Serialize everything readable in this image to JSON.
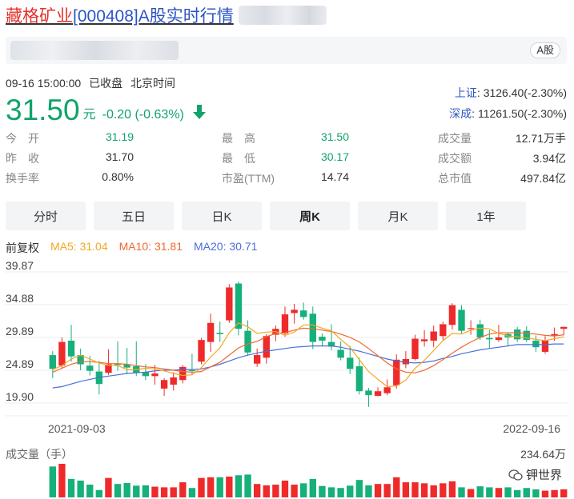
{
  "header": {
    "stock_name": "藏格矿业",
    "stock_suffix": "[000408]A股实时行情",
    "market_badge": "A股"
  },
  "quote": {
    "timestamp": "09-16 15:00:00",
    "status": "已收盘",
    "timezone": "北京时间",
    "price": "31.50",
    "unit": "元",
    "change": "-0.20 (-0.63%)",
    "direction": "down",
    "down_color": "#11a36a"
  },
  "indices": [
    {
      "name": "上证",
      "value": "3126.40(-2.30%)"
    },
    {
      "name": "深成",
      "value": "11261.50(-2.30%)"
    }
  ],
  "stats": {
    "col1": [
      {
        "label": "今　开",
        "value": "31.19",
        "color": "green"
      },
      {
        "label": "昨　收",
        "value": "31.70",
        "color": "dark"
      },
      {
        "label": "换手率",
        "value": "0.80%",
        "color": "dark"
      }
    ],
    "col2": [
      {
        "label": "最　高",
        "value": "31.50",
        "color": "green"
      },
      {
        "label": "最　低",
        "value": "30.17",
        "color": "green"
      },
      {
        "label": "市盈(TTM)",
        "value": "14.74",
        "color": "dark"
      }
    ],
    "col3": [
      {
        "label": "成交量",
        "value": "12.71万手",
        "color": "dark"
      },
      {
        "label": "成交额",
        "value": "3.94亿",
        "color": "dark"
      },
      {
        "label": "总市值",
        "value": "497.84亿",
        "color": "dark"
      }
    ]
  },
  "tabs": [
    {
      "label": "分时",
      "active": false
    },
    {
      "label": "五日",
      "active": false
    },
    {
      "label": "日K",
      "active": false
    },
    {
      "label": "周K",
      "active": true
    },
    {
      "label": "月K",
      "active": false
    },
    {
      "label": "1年",
      "active": false
    }
  ],
  "legend": {
    "adjust": "前复权",
    "ma5": "MA5: 31.04",
    "ma10": "MA10: 31.81",
    "ma20": "MA20: 30.71",
    "ma5_color": "#f5a623",
    "ma10_color": "#ee6a30",
    "ma20_color": "#4a6fd8"
  },
  "chart_data": {
    "type": "candlestick",
    "y_ticks": [
      "39.87",
      "34.88",
      "29.89",
      "24.89",
      "19.90"
    ],
    "ylim": [
      19.9,
      39.87
    ],
    "x_start_label": "2021-09-03",
    "x_end_label": "2022-09-16",
    "up_color": "#ee2a2a",
    "down_color": "#16b07a",
    "candles": [
      {
        "o": 27.2,
        "h": 27.8,
        "l": 23.7,
        "c": 25.1
      },
      {
        "o": 25.6,
        "h": 29.9,
        "l": 25.1,
        "c": 29.2
      },
      {
        "o": 29.4,
        "h": 31.8,
        "l": 26.2,
        "c": 27.0
      },
      {
        "o": 27.2,
        "h": 28.2,
        "l": 24.9,
        "c": 25.8
      },
      {
        "o": 25.6,
        "h": 27.1,
        "l": 24.1,
        "c": 24.8
      },
      {
        "o": 24.7,
        "h": 26.3,
        "l": 21.2,
        "c": 22.8
      },
      {
        "o": 24.5,
        "h": 28.1,
        "l": 24.2,
        "c": 25.8
      },
      {
        "o": 25.9,
        "h": 29.3,
        "l": 24.8,
        "c": 25.7
      },
      {
        "o": 25.8,
        "h": 28.3,
        "l": 24.3,
        "c": 25.3
      },
      {
        "o": 25.5,
        "h": 29.3,
        "l": 24.0,
        "c": 24.5
      },
      {
        "o": 24.6,
        "h": 25.8,
        "l": 23.4,
        "c": 24.0
      },
      {
        "o": 24.0,
        "h": 25.7,
        "l": 22.7,
        "c": 24.4
      },
      {
        "o": 22.1,
        "h": 23.7,
        "l": 21.0,
        "c": 23.4
      },
      {
        "o": 22.7,
        "h": 24.6,
        "l": 21.8,
        "c": 23.8
      },
      {
        "o": 23.4,
        "h": 25.7,
        "l": 22.9,
        "c": 25.4
      },
      {
        "o": 24.9,
        "h": 27.4,
        "l": 24.2,
        "c": 24.8
      },
      {
        "o": 26.2,
        "h": 29.8,
        "l": 25.8,
        "c": 29.5
      },
      {
        "o": 29.2,
        "h": 33.5,
        "l": 27.7,
        "c": 32.1
      },
      {
        "o": 30.6,
        "h": 32.3,
        "l": 29.2,
        "c": 30.4
      },
      {
        "o": 32.5,
        "h": 38.0,
        "l": 32.1,
        "c": 37.5
      },
      {
        "o": 38.1,
        "h": 38.4,
        "l": 30.2,
        "c": 31.2
      },
      {
        "o": 30.9,
        "h": 32.5,
        "l": 27.1,
        "c": 27.6
      },
      {
        "o": 25.9,
        "h": 28.2,
        "l": 25.4,
        "c": 27.2
      },
      {
        "o": 26.8,
        "h": 30.4,
        "l": 25.9,
        "c": 30.1
      },
      {
        "o": 30.3,
        "h": 31.7,
        "l": 29.3,
        "c": 31.2
      },
      {
        "o": 30.5,
        "h": 34.6,
        "l": 30.0,
        "c": 33.4
      },
      {
        "o": 33.6,
        "h": 35.0,
        "l": 32.0,
        "c": 34.1
      },
      {
        "o": 34.0,
        "h": 35.2,
        "l": 32.6,
        "c": 33.0
      },
      {
        "o": 33.5,
        "h": 34.6,
        "l": 28.1,
        "c": 29.2
      },
      {
        "o": 30.0,
        "h": 30.5,
        "l": 28.5,
        "c": 29.4
      },
      {
        "o": 29.2,
        "h": 31.9,
        "l": 27.9,
        "c": 28.5
      },
      {
        "o": 28.0,
        "h": 29.3,
        "l": 26.4,
        "c": 26.8
      },
      {
        "o": 26.8,
        "h": 28.6,
        "l": 24.3,
        "c": 25.1
      },
      {
        "o": 25.5,
        "h": 26.8,
        "l": 21.2,
        "c": 21.7
      },
      {
        "o": 21.8,
        "h": 22.2,
        "l": 19.3,
        "c": 21.1
      },
      {
        "o": 21.0,
        "h": 22.3,
        "l": 20.9,
        "c": 21.7
      },
      {
        "o": 21.4,
        "h": 23.5,
        "l": 21.1,
        "c": 22.3
      },
      {
        "o": 22.6,
        "h": 27.3,
        "l": 22.1,
        "c": 26.5
      },
      {
        "o": 25.8,
        "h": 27.8,
        "l": 25.2,
        "c": 26.6
      },
      {
        "o": 26.6,
        "h": 30.3,
        "l": 26.4,
        "c": 29.7
      },
      {
        "o": 29.3,
        "h": 31.0,
        "l": 28.5,
        "c": 29.6
      },
      {
        "o": 29.4,
        "h": 31.7,
        "l": 28.4,
        "c": 30.8
      },
      {
        "o": 30.1,
        "h": 32.3,
        "l": 29.5,
        "c": 31.9
      },
      {
        "o": 31.8,
        "h": 35.1,
        "l": 31.1,
        "c": 34.8
      },
      {
        "o": 34.1,
        "h": 34.8,
        "l": 30.5,
        "c": 30.9
      },
      {
        "o": 31.3,
        "h": 32.5,
        "l": 30.3,
        "c": 31.3
      },
      {
        "o": 31.9,
        "h": 32.6,
        "l": 29.5,
        "c": 29.9
      },
      {
        "o": 29.8,
        "h": 31.0,
        "l": 28.2,
        "c": 29.6
      },
      {
        "o": 29.5,
        "h": 31.8,
        "l": 29.2,
        "c": 29.9
      },
      {
        "o": 30.4,
        "h": 30.6,
        "l": 28.6,
        "c": 29.9
      },
      {
        "o": 31.1,
        "h": 31.5,
        "l": 29.2,
        "c": 29.6
      },
      {
        "o": 30.9,
        "h": 31.6,
        "l": 29.2,
        "c": 29.5
      },
      {
        "o": 29.4,
        "h": 30.2,
        "l": 27.7,
        "c": 28.4
      },
      {
        "o": 27.7,
        "h": 30.1,
        "l": 27.4,
        "c": 29.4
      },
      {
        "o": 30.2,
        "h": 31.4,
        "l": 29.4,
        "c": 30.4
      },
      {
        "o": 31.2,
        "h": 31.5,
        "l": 30.2,
        "c": 31.5
      }
    ],
    "ma5": [
      25.0,
      25.6,
      26.6,
      27.2,
      26.6,
      26.0,
      25.6,
      25.6,
      25.0,
      25.0,
      25.2,
      25.1,
      24.8,
      24.4,
      24.1,
      24.2,
      25.3,
      26.9,
      28.3,
      30.6,
      32.1,
      31.5,
      30.5,
      30.7,
      30.8,
      30.2,
      30.7,
      31.8,
      31.8,
      31.3,
      30.9,
      29.6,
      28.4,
      26.5,
      24.7,
      23.5,
      22.4,
      22.5,
      23.4,
      25.2,
      26.4,
      27.9,
      29.4,
      30.5,
      30.4,
      31.0,
      31.3,
      31.2,
      30.5,
      30.1,
      30.0,
      29.8,
      29.6,
      29.4,
      29.7,
      30.0
    ],
    "ma10": [
      24.6,
      25.2,
      25.8,
      26.2,
      26.2,
      26.1,
      25.9,
      25.9,
      25.8,
      25.6,
      25.4,
      25.3,
      25.1,
      24.9,
      24.7,
      24.6,
      24.7,
      25.4,
      26.1,
      27.2,
      28.3,
      28.9,
      29.3,
      30.0,
      30.5,
      30.6,
      31.0,
      31.3,
      31.2,
      31.0,
      30.8,
      30.4,
      29.9,
      29.2,
      28.2,
      27.1,
      26.0,
      25.1,
      24.6,
      24.5,
      24.9,
      25.6,
      26.5,
      27.5,
      28.4,
      29.2,
      29.9,
      30.4,
      30.6,
      30.6,
      30.6,
      30.5,
      30.4,
      30.2,
      30.1,
      30.3
    ],
    "ma20": [
      22.2,
      22.4,
      22.8,
      23.2,
      23.5,
      23.8,
      24.0,
      24.2,
      24.4,
      24.5,
      24.6,
      24.8,
      24.9,
      24.9,
      25.0,
      25.0,
      25.1,
      25.4,
      25.8,
      26.3,
      26.8,
      27.2,
      27.5,
      27.8,
      28.0,
      28.2,
      28.4,
      28.5,
      28.6,
      28.6,
      28.6,
      28.4,
      28.1,
      27.8,
      27.4,
      27.0,
      26.6,
      26.3,
      26.1,
      26.0,
      26.1,
      26.3,
      26.7,
      27.0,
      27.4,
      27.7,
      28.0,
      28.2,
      28.4,
      28.6,
      28.8,
      28.8,
      28.8,
      28.8,
      28.9,
      28.9
    ]
  },
  "volume": {
    "title": "成交量（手）",
    "max_label": "234.64万",
    "values": [
      0.92,
      1.0,
      0.55,
      0.5,
      0.38,
      0.22,
      0.58,
      0.4,
      0.43,
      0.35,
      0.36,
      0.32,
      0.3,
      0.3,
      0.45,
      0.28,
      0.58,
      0.6,
      0.6,
      0.62,
      0.66,
      0.68,
      0.4,
      0.36,
      0.38,
      0.5,
      0.38,
      0.42,
      0.55,
      0.34,
      0.3,
      0.28,
      0.35,
      0.52,
      0.36,
      0.4,
      0.4,
      0.6,
      0.45,
      0.45,
      0.42,
      0.36,
      0.42,
      0.48,
      0.3,
      0.25,
      0.33,
      0.3,
      0.28,
      0.3,
      0.22,
      0.28,
      0.24,
      0.2,
      0.22,
      0.24
    ]
  },
  "watermark": {
    "text": "钾世界"
  }
}
